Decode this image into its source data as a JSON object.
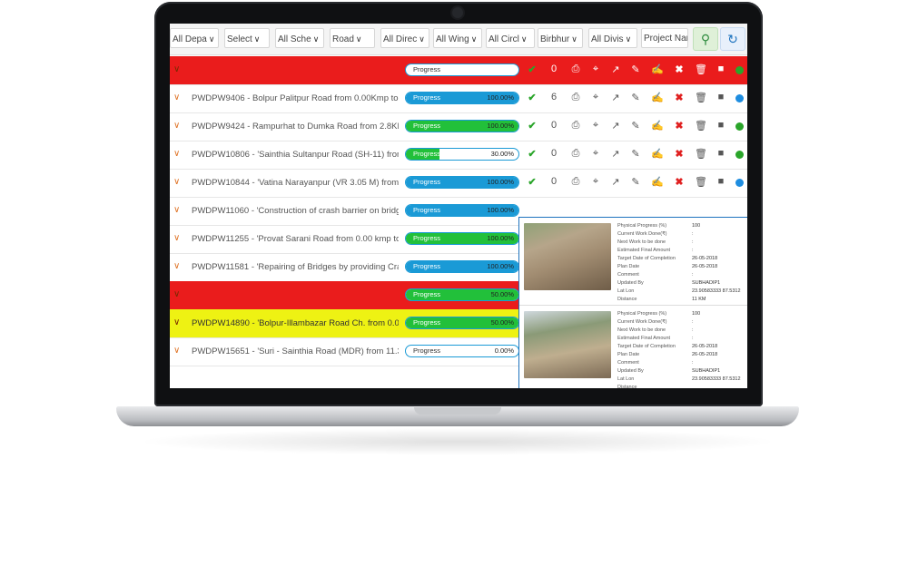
{
  "filters": [
    {
      "label": "All Depa"
    },
    {
      "label": "Select"
    },
    {
      "label": "All Sche"
    },
    {
      "label": "Road"
    },
    {
      "label": "All Direc"
    },
    {
      "label": "All Wing"
    },
    {
      "label": "All Circl"
    },
    {
      "label": "Birbhur"
    },
    {
      "label": "All Divis"
    },
    {
      "label": "Project Nar"
    }
  ],
  "icons": {
    "search": "search-icon",
    "refresh": "refresh-icon",
    "toggle": "chevron-down-icon"
  },
  "colors": {
    "danger_row": "#ea1c1c",
    "warning_row": "#eef213",
    "progress_blue": "#1a9ad6",
    "progress_green": "#22c03a",
    "ok": "#2aa52a"
  },
  "rows": [
    {
      "id": "row0",
      "title": "",
      "progress_label": "Progress",
      "progress_value": "",
      "fill_pct": 0,
      "status": "red",
      "count": "0",
      "dot": "#2aa52a"
    },
    {
      "id": "row1",
      "title": "PWDPW9406 - Bolpur Palitpur Road from 0.00Kmp to 1.20K...",
      "progress_label": "Progress",
      "progress_value": "100.00%",
      "fill_pct": 100,
      "bar": "#1a9ad6",
      "count": "6",
      "dot": "#1e8de0"
    },
    {
      "id": "row2",
      "title": "PWDPW9424 - Rampurhat to Dumka Road from 2.8KMP to...",
      "progress_label": "Progress",
      "progress_value": "100.00%",
      "fill_pct": 100,
      "bar": "#22c03a",
      "count": "0",
      "dot": "#2aa52a"
    },
    {
      "id": "row3",
      "title": "PWDPW10806 - 'Sainthia Sultanpur Road (SH-11) from 1.00...",
      "progress_label": "Progress",
      "progress_value": "30.00%",
      "fill_pct": 30,
      "bar": "#22c03a",
      "count": "0",
      "dot": "#2aa52a"
    },
    {
      "id": "row4",
      "title": "PWDPW10844 - 'Vatina Narayanpur (VR 3.05 M) from 0.00 k...",
      "progress_label": "Progress",
      "progress_value": "100.00%",
      "fill_pct": 100,
      "bar": "#1a9ad6",
      "count": "0",
      "dot": "#1e8de0"
    },
    {
      "id": "row5",
      "title": "PWDPW11060 - 'Construction of crash barrier on bridge ove...",
      "progress_label": "Progress",
      "progress_value": "100.00%",
      "fill_pct": 100,
      "bar": "#1a9ad6"
    },
    {
      "id": "row6",
      "title": "PWDPW11255 - 'Provat Sarani Road from 0.00 kmp to 1.50 k...",
      "progress_label": "Progress",
      "progress_value": "100.00%",
      "fill_pct": 100,
      "bar": "#22c03a"
    },
    {
      "id": "row7",
      "title": "PWDPW11581 - 'Repairing of Bridges by providing Crash Bar...",
      "progress_label": "Progress",
      "progress_value": "100.00%",
      "fill_pct": 100,
      "bar": "#1a9ad6"
    },
    {
      "id": "row8",
      "title": "",
      "progress_label": "Progress",
      "progress_value": "50.00%",
      "fill_pct": 100,
      "bar": "#22c03a",
      "status": "red"
    },
    {
      "id": "row9",
      "title": "PWDPW14890 - 'Bolpur-Illambazar Road Ch. from 0.0 KM to...",
      "progress_label": "Progress",
      "progress_value": "50.00%",
      "fill_pct": 100,
      "bar": "#22c03a",
      "status": "yellow"
    },
    {
      "id": "row10",
      "title": "PWDPW15651 - 'Suri - Sainthia Road (MDR) from 11.30 km...",
      "progress_label": "Progress",
      "progress_value": "0.00%",
      "fill_pct": 0,
      "bar": "#22c03a"
    }
  ],
  "popup": {
    "labels": [
      "Physical Progress (%)",
      "Current Work Done(₹)",
      "Next Work to be done",
      "Estimated Final Amount",
      "Target Date of Completion",
      "Plan Date",
      "Comment",
      "Updated By",
      "Lat Lon",
      "Distance"
    ],
    "entries": [
      {
        "values": [
          "100",
          ":",
          ":",
          ":",
          "26-05-2018",
          "26-05-2018",
          ":",
          "SUBHADIP1",
          "23.90583333 87.5312",
          "11 KM"
        ]
      },
      {
        "values": [
          "100",
          ":",
          ":",
          ":",
          "26-05-2018",
          "26-05-2018",
          ":",
          "SUBHADIP1",
          "23.90583333 87.5312",
          ""
        ]
      }
    ]
  }
}
